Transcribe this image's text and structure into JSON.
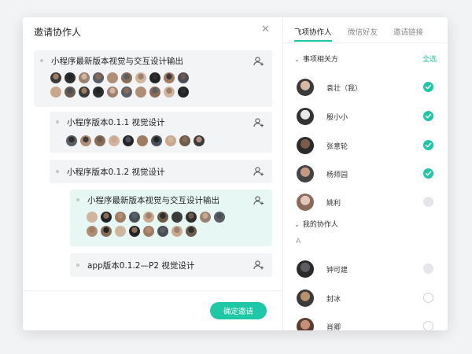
{
  "dialog": {
    "title": "邀请协作人",
    "confirm_label": "确定邀请"
  },
  "tasks": [
    {
      "name": "小程序最新版本视觉与交互设计输出",
      "avatar_count": 20
    },
    {
      "name": "小程序版本0.1.1 视觉设计",
      "avatar_count": 10
    },
    {
      "name": "小程序版本0.1.2 视觉设计",
      "avatar_count": 0
    },
    {
      "name": "小程序最新版本视觉与交互设计输出",
      "avatar_count": 18,
      "active": true
    },
    {
      "name": "app版本0.1.2—P2 视觉设计",
      "avatar_count": 0
    }
  ],
  "tabs": [
    "飞项协作人",
    "微信好友",
    "邀请链接"
  ],
  "active_tab": "飞项协作人",
  "sections": {
    "related": "事项相关方",
    "select_all": "全选",
    "mine": "我的协作人",
    "letter": "A"
  },
  "people": [
    {
      "name": "袁壮（我）",
      "state": "checked"
    },
    {
      "name": "殷小小",
      "state": "checked"
    },
    {
      "name": "张意轮",
      "state": "checked"
    },
    {
      "name": "杨师园",
      "state": "checked"
    },
    {
      "name": "姚利",
      "state": "disabled"
    },
    {
      "name": "钟可建",
      "state": "disabled"
    },
    {
      "name": "封冰",
      "state": "unchecked"
    },
    {
      "name": "肖卿",
      "state": "unchecked"
    }
  ],
  "colors": {
    "accent": "#1ec7a5",
    "active_task_bg": "#e6f7f4"
  }
}
